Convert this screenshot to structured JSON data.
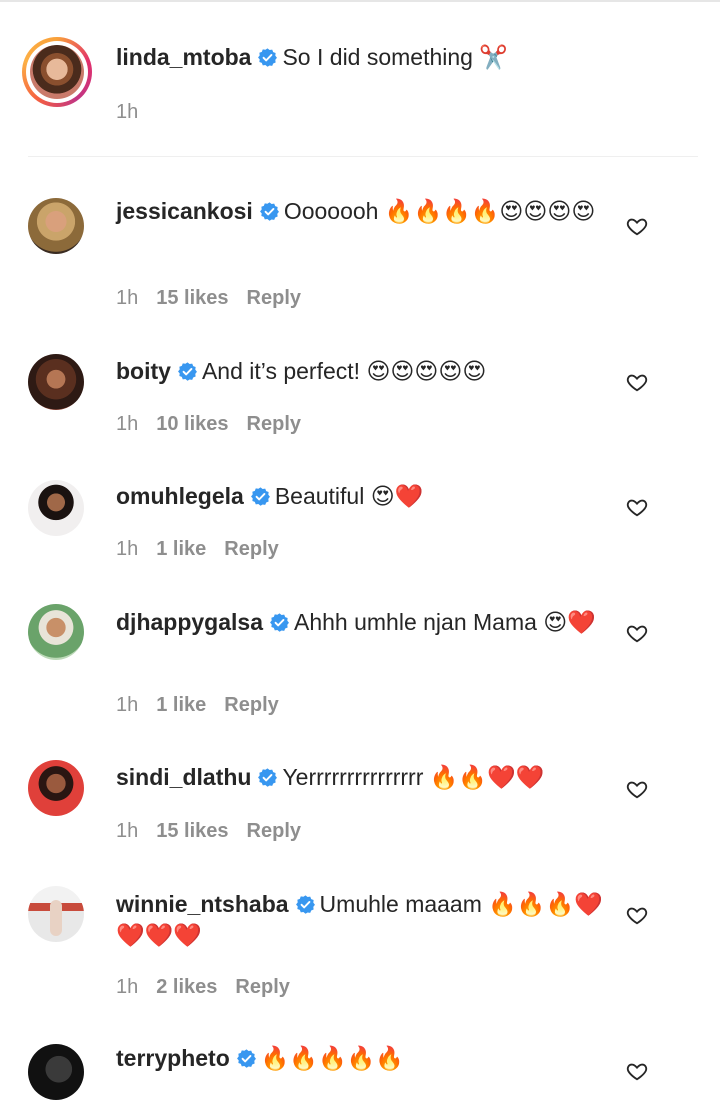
{
  "caption": {
    "username": "linda_mtoba",
    "text": "So I did something",
    "emoji": "✂️",
    "time": "1h"
  },
  "colors": {
    "verified": "#3897f0",
    "meta": "#8e8e8e",
    "text": "#262626",
    "story_ring": "#e1306c"
  },
  "icons": {
    "verified": "verified-badge-icon",
    "like": "heart-outline-icon"
  },
  "comments": [
    {
      "username": "jessicankosi",
      "text": "Ooooooh",
      "emojis": "🔥🔥🔥🔥😍😍😍😍",
      "time": "1h",
      "likes": "15 likes",
      "reply": "Reply"
    },
    {
      "username": "boity",
      "text": "And it’s perfect!",
      "emojis": "😍😍😍😍😍",
      "time": "1h",
      "likes": "10 likes",
      "reply": "Reply"
    },
    {
      "username": "omuhlegela",
      "text": "Beautiful",
      "emojis": "😍❤️",
      "time": "1h",
      "likes": "1 like",
      "reply": "Reply"
    },
    {
      "username": "djhappygalsa",
      "text": "Ahhh umhle njan Mama",
      "emojis": "😍❤️",
      "time": "1h",
      "likes": "1 like",
      "reply": "Reply"
    },
    {
      "username": "sindi_dlathu",
      "text": "Yerrrrrrrrrrrrrrr",
      "emojis": "🔥🔥❤️❤️",
      "time": "1h",
      "likes": "15 likes",
      "reply": "Reply"
    },
    {
      "username": "winnie_ntshaba",
      "text": "Umuhle maaam",
      "emojis": "🔥🔥🔥❤️❤️❤️❤️",
      "time": "1h",
      "likes": "2 likes",
      "reply": "Reply"
    },
    {
      "username": "terrypheto",
      "text": "",
      "emojis": "🔥🔥🔥🔥🔥",
      "time": "",
      "likes": "",
      "reply": ""
    }
  ]
}
